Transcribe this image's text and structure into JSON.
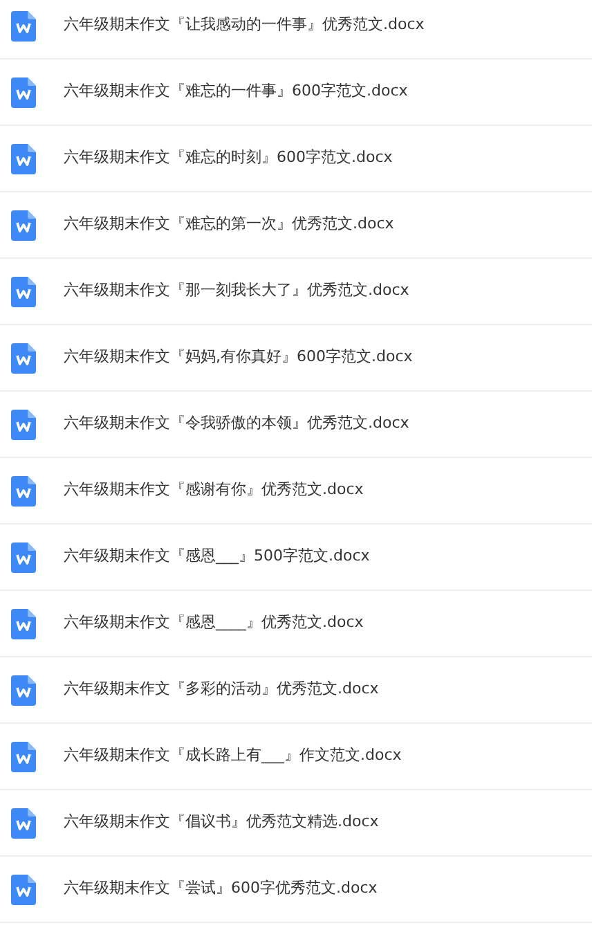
{
  "files": [
    {
      "name": "六年级期末作文『让我感动的一件事』优秀范文.docx"
    },
    {
      "name": "六年级期末作文『难忘的一件事』600字范文.docx"
    },
    {
      "name": "六年级期末作文『难忘的时刻』600字范文.docx"
    },
    {
      "name": "六年级期末作文『难忘的第一次』优秀范文.docx"
    },
    {
      "name": "六年级期末作文『那一刻我长大了』优秀范文.docx"
    },
    {
      "name": "六年级期末作文『妈妈,有你真好』600字范文.docx"
    },
    {
      "name": "六年级期末作文『令我骄傲的本领』优秀范文.docx"
    },
    {
      "name": "六年级期末作文『感谢有你』优秀范文.docx"
    },
    {
      "name": "六年级期末作文『感恩___』500字范文.docx"
    },
    {
      "name": "六年级期末作文『感恩____』优秀范文.docx"
    },
    {
      "name": "六年级期末作文『多彩的活动』优秀范文.docx"
    },
    {
      "name": "六年级期末作文『成长路上有___』作文范文.docx"
    },
    {
      "name": "六年级期末作文『倡议书』优秀范文精选.docx"
    },
    {
      "name": "六年级期末作文『尝试』600字优秀范文.docx"
    }
  ]
}
